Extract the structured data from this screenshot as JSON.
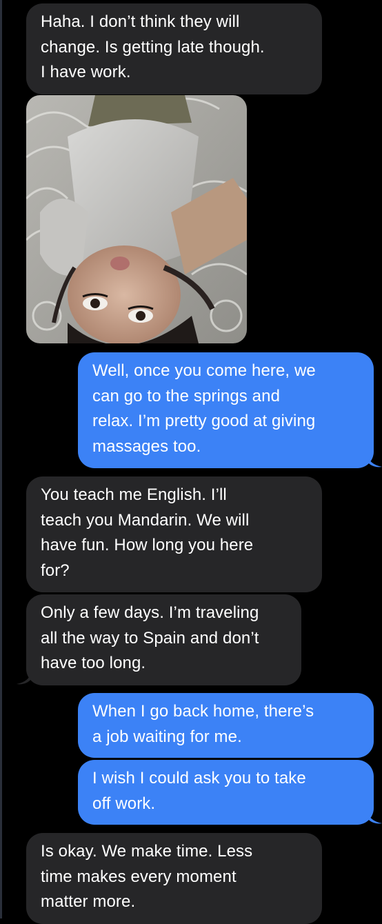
{
  "conversation": {
    "messages": [
      {
        "direction": "incoming",
        "text": "Haha. I don’t think they will\nchange. Is getting late though.\nI have work."
      },
      {
        "direction": "incoming",
        "type": "photo",
        "icon": "selfie-photo"
      },
      {
        "direction": "outgoing",
        "text": "Well, once you come here, we\ncan go to the springs and\nrelax. I’m pretty good at giving\nmassages too."
      },
      {
        "direction": "incoming",
        "text": "You teach me English. I’ll\nteach you Mandarin. We will\nhave fun. How long you here\nfor?"
      },
      {
        "direction": "incoming",
        "text": "Only a few days. I’m traveling\nall the way to Spain and don’t\nhave too long."
      },
      {
        "direction": "outgoing",
        "text": "When I go back home, there’s\na job waiting for me."
      },
      {
        "direction": "outgoing",
        "text": "I wish I could ask you to take\noff work."
      },
      {
        "direction": "incoming",
        "text": "Is okay. We make time. Less\ntime makes every moment\nmatter more."
      }
    ]
  },
  "colors": {
    "background": "#000000",
    "incoming_bubble": "#262628",
    "outgoing_bubble": "#3c82f6",
    "text": "#ffffff"
  }
}
